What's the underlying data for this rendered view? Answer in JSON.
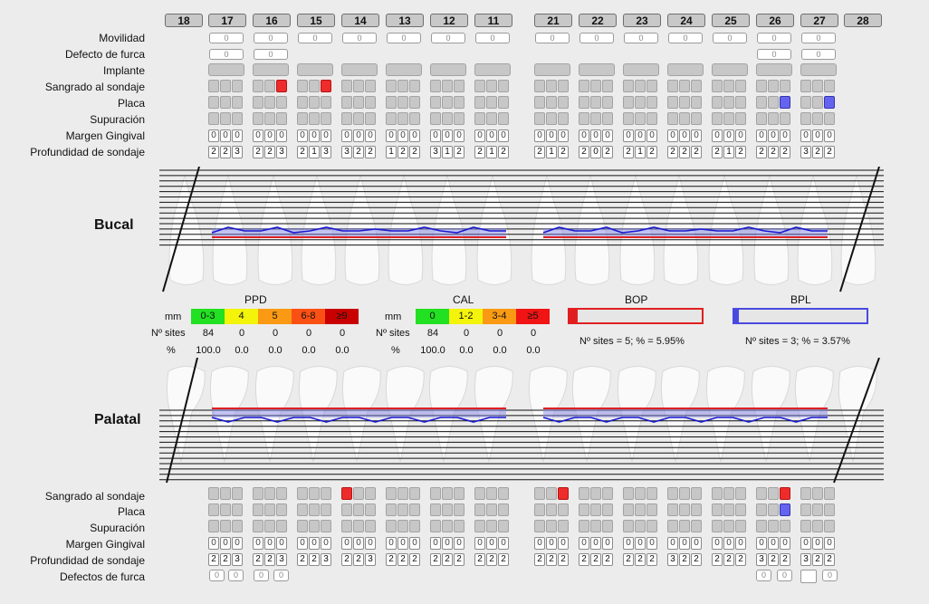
{
  "upper_teeth": [
    "18",
    "17",
    "16",
    "15",
    "14",
    "13",
    "12",
    "11",
    "21",
    "22",
    "23",
    "24",
    "25",
    "26",
    "27",
    "28"
  ],
  "upper_rows": {
    "movilidad": "Movilidad",
    "furca": "Defecto de furca",
    "implante": "Implante",
    "bop": "Sangrado al sondaje",
    "placa": "Placa",
    "supuracion": "Supuración",
    "margen": "Margen Gingival",
    "profundidad": "Profundidad de sondaje"
  },
  "zero": "0",
  "upper_depth": [
    [
      "2",
      "2",
      "3"
    ],
    [
      "2",
      "2",
      "3"
    ],
    [
      "2",
      "1",
      "3"
    ],
    [
      "3",
      "2",
      "2"
    ],
    [
      "1",
      "2",
      "2"
    ],
    [
      "3",
      "1",
      "2"
    ],
    [
      "2",
      "1",
      "2"
    ],
    [
      "2",
      "1",
      "2"
    ],
    [
      "2",
      "0",
      "2"
    ],
    [
      "2",
      "1",
      "2"
    ],
    [
      "2",
      "2",
      "2"
    ],
    [
      "2",
      "1",
      "2"
    ],
    [
      "2",
      "2",
      "2"
    ],
    [
      "3",
      "2",
      "2"
    ]
  ],
  "sections": {
    "bucal": "Bucal",
    "palatal": "Palatal"
  },
  "ppd": {
    "title": "PPD",
    "mm": "mm",
    "sites_label": "Nº sites",
    "pct_label": "%",
    "cats": [
      "0-3",
      "4",
      "5",
      "6-8",
      "≥9"
    ],
    "colors": [
      "#22e022",
      "#f4f40a",
      "#fa9a14",
      "#fa5014",
      "#c80000"
    ],
    "sites": [
      "84",
      "0",
      "0",
      "0",
      "0"
    ],
    "pct": [
      "100.0",
      "0.0",
      "0.0",
      "0.0",
      "0.0"
    ]
  },
  "cal": {
    "title": "CAL",
    "mm": "mm",
    "sites_label": "Nº sites",
    "pct_label": "%",
    "cats": [
      "0",
      "1-2",
      "3-4",
      "≥5"
    ],
    "colors": [
      "#22e022",
      "#f4f40a",
      "#fa9a14",
      "#f01414"
    ],
    "sites": [
      "84",
      "0",
      "0",
      "0"
    ],
    "pct": [
      "100.0",
      "0.0",
      "0.0",
      "0.0"
    ]
  },
  "bop": {
    "title": "BOP",
    "summary": "Nº sites = 5; % = 5.95%",
    "percent": 5.95,
    "color": "#e02020"
  },
  "bpl": {
    "title": "BPL",
    "summary": "Nº sites = 3; % = 3.57%",
    "percent": 3.57,
    "color": "#4a4ae0"
  },
  "lower_rows": {
    "bop": "Sangrado al sondaje",
    "placa": "Placa",
    "supuracion": "Supuración",
    "margen": "Margen Gingival",
    "profundidad": "Profundidad de sondaje",
    "furca": "Defectos de furca"
  },
  "lower_depth": [
    [
      "2",
      "2",
      "3"
    ],
    [
      "2",
      "2",
      "3"
    ],
    [
      "2",
      "2",
      "3"
    ],
    [
      "2",
      "2",
      "3"
    ],
    [
      "2",
      "2",
      "2"
    ],
    [
      "2",
      "2",
      "2"
    ],
    [
      "2",
      "2",
      "2"
    ],
    [
      "2",
      "2",
      "2"
    ],
    [
      "2",
      "2",
      "2"
    ],
    [
      "2",
      "2",
      "2"
    ],
    [
      "3",
      "2",
      "2"
    ],
    [
      "2",
      "2",
      "2"
    ],
    [
      "3",
      "2",
      "2"
    ],
    [
      "3",
      "2",
      "2"
    ]
  ]
}
